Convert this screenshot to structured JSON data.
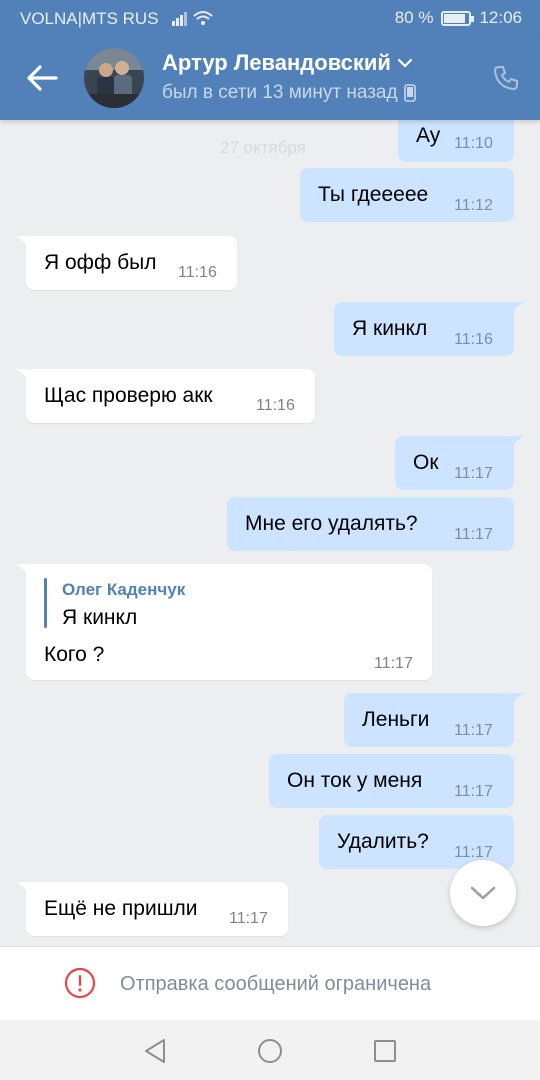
{
  "status_bar": {
    "carrier": "VOLNA|MTS RUS",
    "battery": "80 %",
    "time": "12:06"
  },
  "header": {
    "name": "Артур Левандовский",
    "status": "был в сети 13 минут назад"
  },
  "date_divider": "27 октября",
  "messages": [
    {
      "dir": "out",
      "text": "Ау",
      "time": "11:10"
    },
    {
      "dir": "out",
      "text": "Ты гдеееее",
      "time": "11:12"
    },
    {
      "dir": "in",
      "text": "Я офф был",
      "time": "11:16"
    },
    {
      "dir": "out",
      "text": "Я кинкл",
      "time": "11:16"
    },
    {
      "dir": "in",
      "text": "Щас проверю акк",
      "time": "11:16"
    },
    {
      "dir": "out",
      "text": "Ок",
      "time": "11:17"
    },
    {
      "dir": "out",
      "text": "Мне его удалять?",
      "time": "11:17"
    },
    {
      "dir": "in",
      "text": "Кого ?",
      "time": "11:17",
      "reply_author": "Олег Каденчук",
      "reply_text": "Я кинкл"
    },
    {
      "dir": "out",
      "text": "Леньги",
      "time": "11:17"
    },
    {
      "dir": "out",
      "text": "Он ток у меня",
      "time": "11:17"
    },
    {
      "dir": "out",
      "text": "Удалить?",
      "time": "11:17"
    },
    {
      "dir": "in",
      "text": "Ещё не пришли",
      "time": "11:17"
    }
  ],
  "restriction_text": "Отправка сообщений ограничена",
  "colors": {
    "accent": "#5181b8",
    "outgoing_bubble": "#cce4ff",
    "incoming_bubble": "#ffffff",
    "warning": "#e64646"
  },
  "icons": {
    "back": "arrow-left-icon",
    "phone": "phone-icon",
    "scroll_down": "chevron-down-icon",
    "warning": "exclamation-circle-icon"
  }
}
